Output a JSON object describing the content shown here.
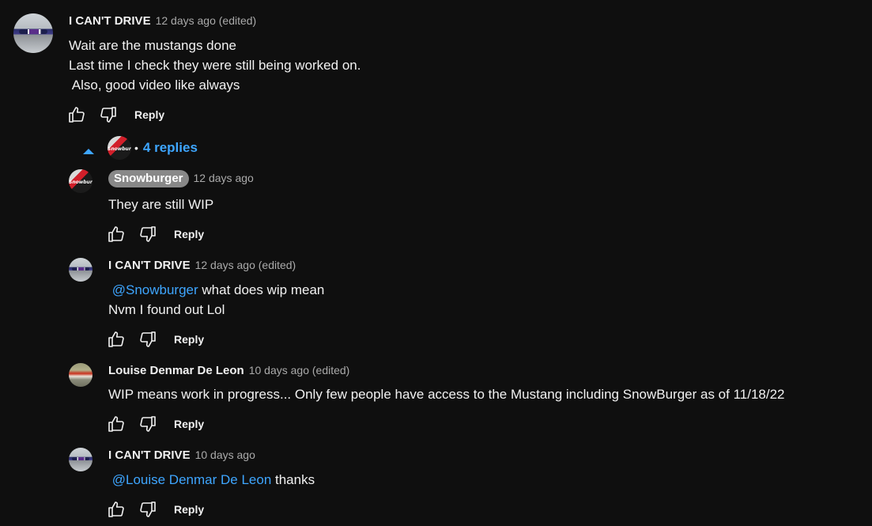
{
  "comments": [
    {
      "author": "I CAN'T DRIVE",
      "time": "12 days ago (edited)",
      "lines": [
        "Wait are the mustangs done",
        "Last time I check they were still being worked on.",
        " Also, good video like always"
      ],
      "reply_label": "Reply"
    },
    {
      "author": "Snowburger",
      "time": "12 days ago",
      "lines": [
        "They are still WIP"
      ],
      "reply_label": "Reply"
    },
    {
      "author": "I CAN'T DRIVE",
      "time": "12 days ago (edited)",
      "mention": "@Snowburger",
      "mention_text": " what does wip mean",
      "lines": [
        "Nvm I found out Lol"
      ],
      "reply_label": "Reply"
    },
    {
      "author": "Louise Denmar De Leon",
      "time": "10 days ago (edited)",
      "lines": [
        "WIP means work in progress... Only few people have access to the Mustang including SnowBurger as of 11/18/22"
      ],
      "reply_label": "Reply"
    },
    {
      "author": "I CAN'T DRIVE",
      "time": "10 days ago",
      "mention": "@Louise Denmar De Leon",
      "mention_text": " thanks",
      "reply_label": "Reply"
    }
  ],
  "replies_toggle": {
    "count_label": "4 replies",
    "dot": "•"
  },
  "avatar_text": {
    "snowburger": "Snowburger"
  },
  "colors": {
    "background": "#0f0f0f",
    "link": "#3ea6ff",
    "muted": "#aaaaaa",
    "pill": "#888888"
  },
  "icons": [
    "like-icon",
    "dislike-icon",
    "collapse-caret-icon"
  ]
}
